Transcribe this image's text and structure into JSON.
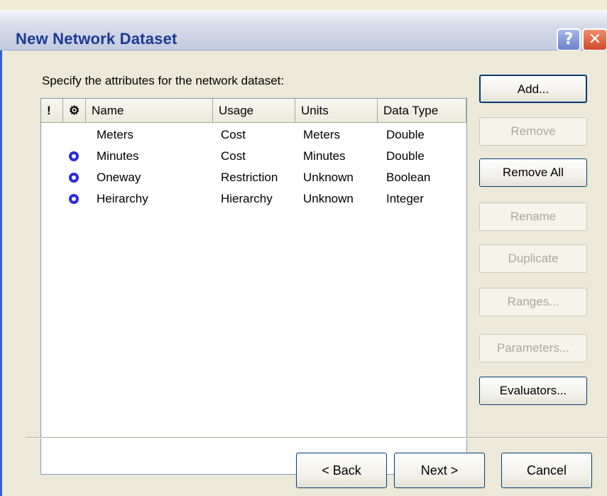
{
  "window": {
    "title": "New Network Dataset",
    "help_label": "?",
    "close_label": "✕"
  },
  "instruction": "Specify the attributes for the network dataset:",
  "table": {
    "headers": [
      "!",
      "⚙",
      "Name",
      "Usage",
      "Units",
      "Data Type"
    ],
    "rows": [
      {
        "default": false,
        "name": "Meters",
        "usage": "Cost",
        "units": "Meters",
        "data_type": "Double"
      },
      {
        "default": true,
        "name": "Minutes",
        "usage": "Cost",
        "units": "Minutes",
        "data_type": "Double"
      },
      {
        "default": true,
        "name": "Oneway",
        "usage": "Restriction",
        "units": "Unknown",
        "data_type": "Boolean"
      },
      {
        "default": true,
        "name": "Heirarchy",
        "usage": "Hierarchy",
        "units": "Unknown",
        "data_type": "Integer"
      }
    ]
  },
  "side_buttons": {
    "add": "Add...",
    "remove": "Remove",
    "remove_all": "Remove All",
    "rename": "Rename",
    "duplicate": "Duplicate",
    "ranges": "Ranges...",
    "parameters": "Parameters...",
    "evaluators": "Evaluators..."
  },
  "nav": {
    "back": "< Back",
    "next": "Next >",
    "cancel": "Cancel"
  },
  "colors": {
    "title_text": "#1c3b93",
    "gear_icon": "#2b2bd6",
    "disabled_text": "#aca899"
  }
}
